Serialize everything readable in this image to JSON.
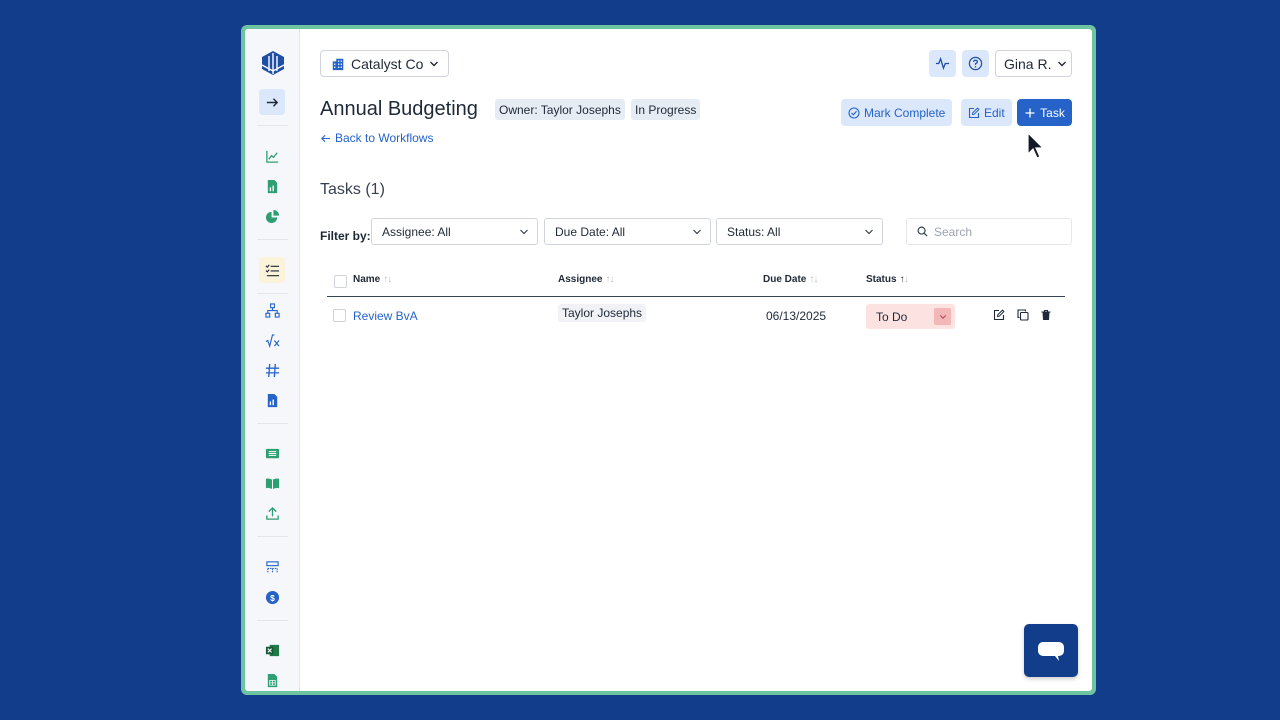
{
  "company": {
    "name": "Catalyst Co"
  },
  "user": {
    "name": "Gina R."
  },
  "header_icons": [
    "activity-icon",
    "help-icon"
  ],
  "workflow": {
    "title": "Annual Budgeting",
    "owner_tag": "Owner: Taylor Josephs",
    "status_tag": "In Progress",
    "back_link": "Back to Workflows"
  },
  "actions": {
    "mark_complete": "Mark Complete",
    "edit": "Edit",
    "add_task": "Task"
  },
  "tasks": {
    "heading": "Tasks (1)",
    "filter_label": "Filter by:",
    "filters": {
      "assignee": "Assignee: All",
      "due_date": "Due Date: All",
      "status": "Status: All"
    },
    "search_placeholder": "Search",
    "columns": {
      "name": "Name",
      "assignee": "Assignee",
      "due_date": "Due Date",
      "status": "Status"
    },
    "rows": [
      {
        "name": "Review BvA",
        "assignee": "Taylor Josephs",
        "due_date": "06/13/2025",
        "status": "To Do"
      }
    ]
  },
  "colors": {
    "background": "#123d8a",
    "frame": "#6cc4a1",
    "primary": "#2563c9",
    "soft_button": "#dbe7fb",
    "status_todo": "#fde2e2",
    "status_todo_dropdown": "#f4b7b7"
  },
  "sidebar_icons": [
    "logo-icon",
    "expand-arrow-icon",
    "line-chart-icon",
    "report-icon",
    "pie-chart-icon",
    "checklist-icon",
    "hierarchy-icon",
    "formula-icon",
    "hash-icon",
    "document-chart-icon",
    "table-icon",
    "book-icon",
    "upload-icon",
    "sitemap-icon",
    "dollar-icon",
    "excel-icon",
    "sheets-icon"
  ]
}
